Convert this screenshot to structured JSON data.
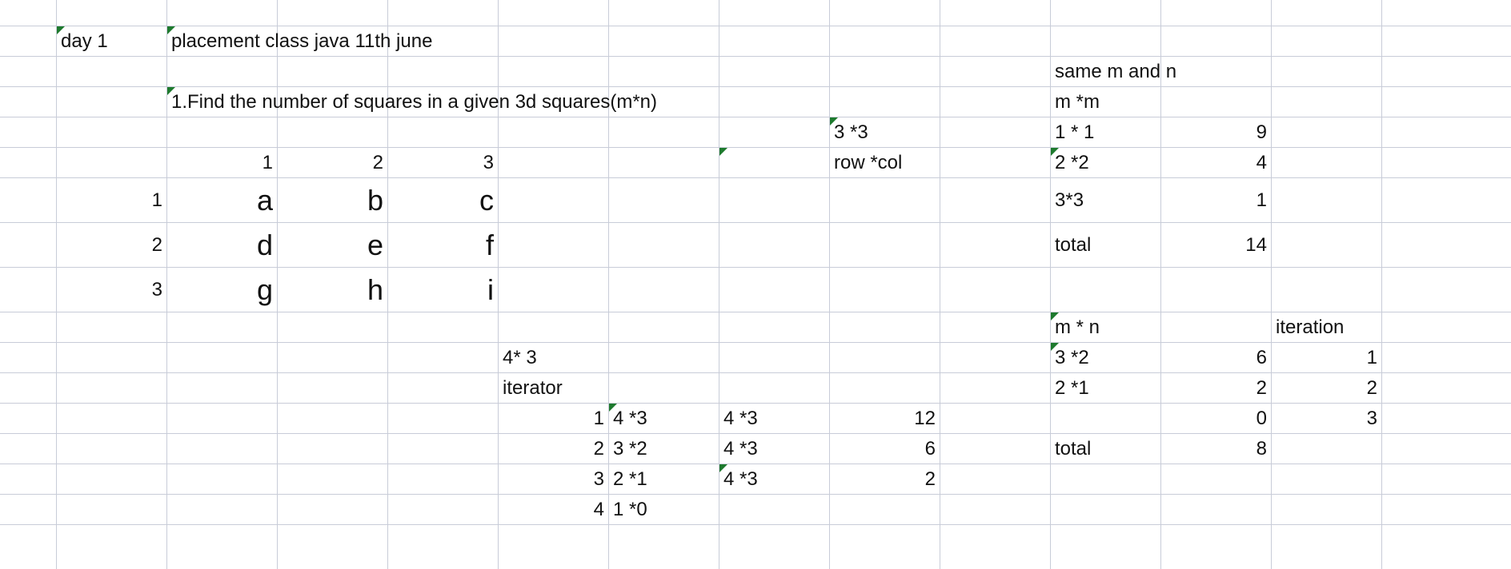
{
  "sheet": {
    "cells": [
      {
        "id": "day-label",
        "text": "day 1",
        "align": "left",
        "size": "normal",
        "flag": true
      },
      {
        "id": "title",
        "text": "placement class java 11th june",
        "align": "left",
        "size": "normal",
        "flag": true
      },
      {
        "id": "same-m-n",
        "text": "same m and n",
        "align": "left",
        "size": "normal",
        "flag": false
      },
      {
        "id": "problem",
        "text": "1.Find the number of squares in a given 3d squares(m*n)",
        "align": "left",
        "size": "normal",
        "flag": true
      },
      {
        "id": "m-m",
        "text": "m *m",
        "align": "left",
        "size": "normal",
        "flag": false
      },
      {
        "id": "three-three",
        "text": "3 *3",
        "align": "left",
        "size": "normal",
        "flag": true
      },
      {
        "id": "sq-1x1",
        "text": "1 * 1",
        "align": "left",
        "size": "normal",
        "flag": false
      },
      {
        "id": "sq-1x1-val",
        "text": "9",
        "align": "right",
        "size": "normal",
        "flag": false
      },
      {
        "id": "col-h1",
        "text": "1",
        "align": "right",
        "size": "normal",
        "flag": false
      },
      {
        "id": "col-h2",
        "text": "2",
        "align": "right",
        "size": "normal",
        "flag": false
      },
      {
        "id": "col-h3",
        "text": "3",
        "align": "right",
        "size": "normal",
        "flag": false
      },
      {
        "id": "empty-flag",
        "text": "",
        "align": "left",
        "size": "normal",
        "flag": true
      },
      {
        "id": "row-col",
        "text": "row *col",
        "align": "left",
        "size": "normal",
        "flag": false
      },
      {
        "id": "sq-2x2",
        "text": "2 *2",
        "align": "left",
        "size": "normal",
        "flag": true
      },
      {
        "id": "sq-2x2-val",
        "text": "4",
        "align": "right",
        "size": "normal",
        "flag": false
      },
      {
        "id": "row-h1",
        "text": "1",
        "align": "right",
        "size": "normal",
        "flag": false
      },
      {
        "id": "grid-a",
        "text": "a",
        "align": "right",
        "size": "big",
        "flag": false
      },
      {
        "id": "grid-b",
        "text": "b",
        "align": "right",
        "size": "big",
        "flag": false
      },
      {
        "id": "grid-c",
        "text": "c",
        "align": "right",
        "size": "big",
        "flag": false
      },
      {
        "id": "sq-3x3",
        "text": "3*3",
        "align": "left",
        "size": "normal",
        "flag": false
      },
      {
        "id": "sq-3x3-val",
        "text": "1",
        "align": "right",
        "size": "normal",
        "flag": false
      },
      {
        "id": "row-h2",
        "text": "2",
        "align": "right",
        "size": "normal",
        "flag": false
      },
      {
        "id": "grid-d",
        "text": "d",
        "align": "right",
        "size": "big",
        "flag": false
      },
      {
        "id": "grid-e",
        "text": "e",
        "align": "right",
        "size": "big",
        "flag": false
      },
      {
        "id": "grid-f",
        "text": "f",
        "align": "right",
        "size": "big",
        "flag": false
      },
      {
        "id": "total-1-label",
        "text": "total",
        "align": "left",
        "size": "normal",
        "flag": false
      },
      {
        "id": "total-1-val",
        "text": "14",
        "align": "right",
        "size": "normal",
        "flag": false
      },
      {
        "id": "row-h3",
        "text": "3",
        "align": "right",
        "size": "normal",
        "flag": false
      },
      {
        "id": "grid-g",
        "text": "g",
        "align": "right",
        "size": "big",
        "flag": false
      },
      {
        "id": "grid-h",
        "text": "h",
        "align": "right",
        "size": "big",
        "flag": false
      },
      {
        "id": "grid-i",
        "text": "i",
        "align": "right",
        "size": "big",
        "flag": false
      },
      {
        "id": "m-n",
        "text": "m  * n",
        "align": "left",
        "size": "normal",
        "flag": true
      },
      {
        "id": "iteration-h",
        "text": "iteration",
        "align": "left",
        "size": "normal",
        "flag": false
      },
      {
        "id": "four-three",
        "text": "4* 3",
        "align": "left",
        "size": "normal",
        "flag": false
      },
      {
        "id": "mn-3x2",
        "text": "3 *2",
        "align": "left",
        "size": "normal",
        "flag": true
      },
      {
        "id": "mn-3x2-val",
        "text": "6",
        "align": "right",
        "size": "normal",
        "flag": false
      },
      {
        "id": "mn-iter-1",
        "text": "1",
        "align": "right",
        "size": "normal",
        "flag": false
      },
      {
        "id": "iterator-h",
        "text": "iterator",
        "align": "left",
        "size": "normal",
        "flag": false
      },
      {
        "id": "mn-2x1",
        "text": "2 *1",
        "align": "left",
        "size": "normal",
        "flag": false
      },
      {
        "id": "mn-2x1-val",
        "text": "2",
        "align": "right",
        "size": "normal",
        "flag": false
      },
      {
        "id": "mn-iter-2",
        "text": "2",
        "align": "right",
        "size": "normal",
        "flag": false
      },
      {
        "id": "it-1",
        "text": "1",
        "align": "right",
        "size": "normal",
        "flag": false
      },
      {
        "id": "it-1-a",
        "text": "4 *3",
        "align": "left",
        "size": "normal",
        "flag": true
      },
      {
        "id": "it-1-b",
        "text": "4 *3",
        "align": "left",
        "size": "normal",
        "flag": false
      },
      {
        "id": "it-1-val",
        "text": "12",
        "align": "right",
        "size": "normal",
        "flag": false
      },
      {
        "id": "mn-zero",
        "text": "0",
        "align": "right",
        "size": "normal",
        "flag": false
      },
      {
        "id": "mn-iter-3",
        "text": "3",
        "align": "right",
        "size": "normal",
        "flag": false
      },
      {
        "id": "it-2",
        "text": "2",
        "align": "right",
        "size": "normal",
        "flag": false
      },
      {
        "id": "it-2-a",
        "text": "3 *2",
        "align": "left",
        "size": "normal",
        "flag": false
      },
      {
        "id": "it-2-b",
        "text": "4 *3",
        "align": "left",
        "size": "normal",
        "flag": false
      },
      {
        "id": "it-2-val",
        "text": "6",
        "align": "right",
        "size": "normal",
        "flag": false
      },
      {
        "id": "total-2-label",
        "text": "total",
        "align": "left",
        "size": "normal",
        "flag": false
      },
      {
        "id": "total-2-val",
        "text": "8",
        "align": "right",
        "size": "normal",
        "flag": false
      },
      {
        "id": "it-3",
        "text": "3",
        "align": "right",
        "size": "normal",
        "flag": false
      },
      {
        "id": "it-3-a",
        "text": "2 *1",
        "align": "left",
        "size": "normal",
        "flag": false
      },
      {
        "id": "it-3-b",
        "text": "4 *3",
        "align": "left",
        "size": "normal",
        "flag": true
      },
      {
        "id": "it-3-val",
        "text": "2",
        "align": "right",
        "size": "normal",
        "flag": false
      },
      {
        "id": "it-4",
        "text": "4",
        "align": "right",
        "size": "normal",
        "flag": false
      },
      {
        "id": "it-4-a",
        "text": "1 *0",
        "align": "left",
        "size": "normal",
        "flag": false
      }
    ]
  },
  "colors": {
    "grid_line": "#c8ccd8",
    "text": "#111111",
    "comment_flag": "#1e7a2e",
    "background": "#ffffff"
  }
}
